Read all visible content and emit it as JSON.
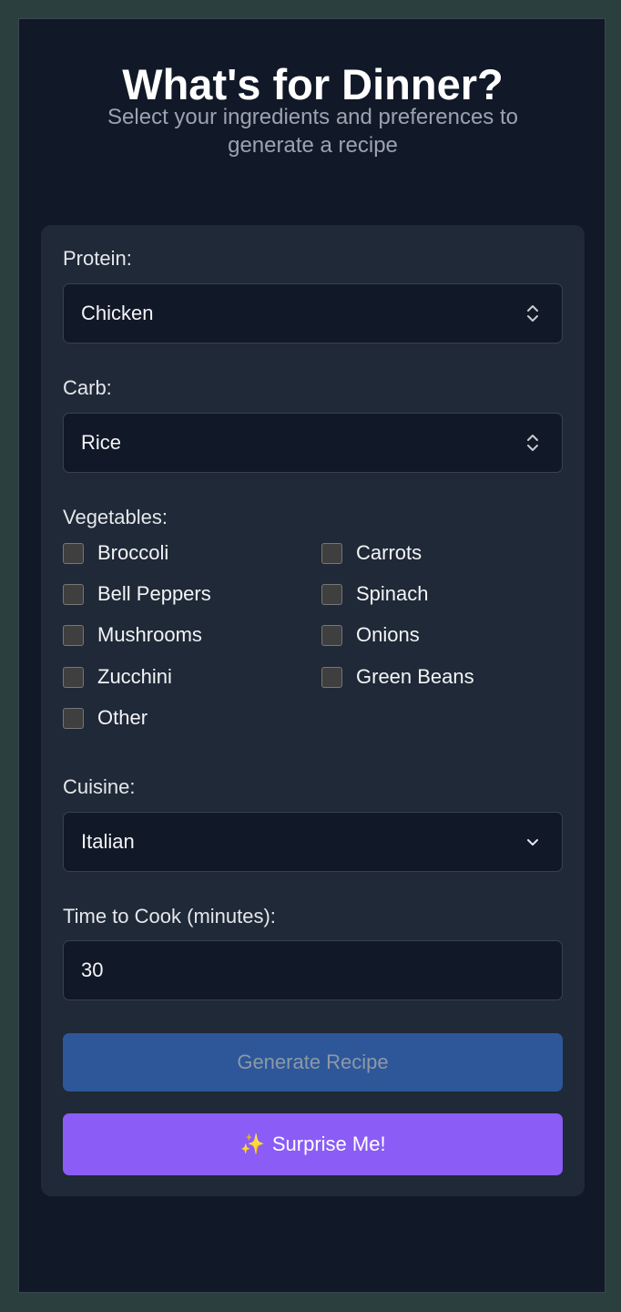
{
  "header": {
    "title": "What's for Dinner?",
    "subtitle": "Select your ingredients and preferences to generate a recipe"
  },
  "form": {
    "protein": {
      "label": "Protein:",
      "value": "Chicken",
      "icon": "up-down-chevron-icon"
    },
    "carb": {
      "label": "Carb:",
      "value": "Rice",
      "icon": "up-down-chevron-icon"
    },
    "vegetables": {
      "label": "Vegetables:",
      "options": [
        {
          "label": "Broccoli",
          "checked": false
        },
        {
          "label": "Carrots",
          "checked": false
        },
        {
          "label": "Bell Peppers",
          "checked": false
        },
        {
          "label": "Spinach",
          "checked": false
        },
        {
          "label": "Mushrooms",
          "checked": false
        },
        {
          "label": "Onions",
          "checked": false
        },
        {
          "label": "Zucchini",
          "checked": false
        },
        {
          "label": "Green Beans",
          "checked": false
        },
        {
          "label": "Other",
          "checked": false
        }
      ]
    },
    "cuisine": {
      "label": "Cuisine:",
      "value": "Italian",
      "icon": "chevron-down-icon"
    },
    "time": {
      "label": "Time to Cook (minutes):",
      "value": "30"
    }
  },
  "buttons": {
    "generate_label": "Generate Recipe",
    "surprise_icon": "✨",
    "surprise_label": "Surprise Me!"
  },
  "colors": {
    "page_background": "#2b3f3f",
    "panel_background": "#111827",
    "card_background": "#1f2937",
    "generate_button": "#2d5799",
    "surprise_button": "#8b5cf6"
  }
}
